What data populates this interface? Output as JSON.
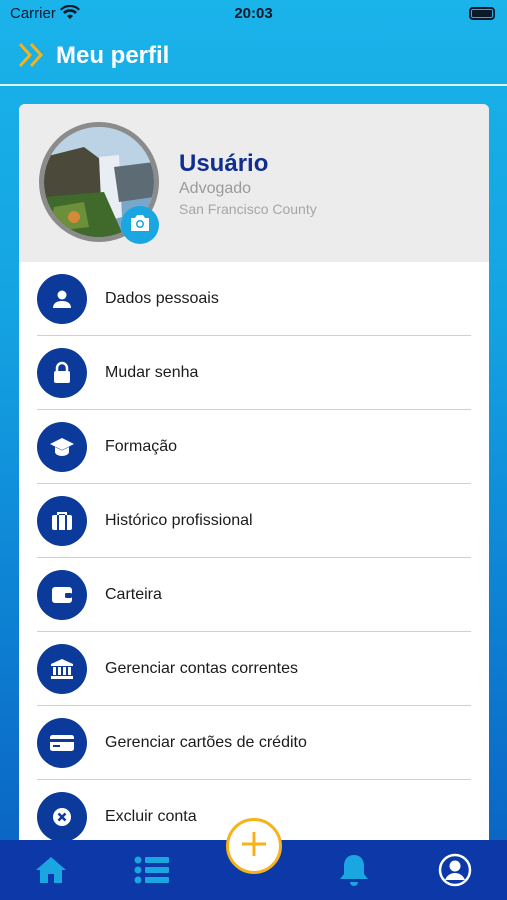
{
  "status_bar": {
    "carrier": "Carrier",
    "time": "20:03"
  },
  "header": {
    "title": "Meu perfil"
  },
  "profile": {
    "name": "Usuário",
    "role": "Advogado",
    "location": "San Francisco County"
  },
  "menu": [
    {
      "label": "Dados pessoais",
      "icon": "person-icon"
    },
    {
      "label": "Mudar senha",
      "icon": "lock-icon"
    },
    {
      "label": "Formação",
      "icon": "graduation-cap-icon"
    },
    {
      "label": "Histórico profissional",
      "icon": "briefcase-icon"
    },
    {
      "label": "Carteira",
      "icon": "wallet-icon"
    },
    {
      "label": "Gerenciar contas correntes",
      "icon": "bank-icon"
    },
    {
      "label": "Gerenciar cartões de crédito",
      "icon": "credit-card-icon"
    },
    {
      "label": "Excluir conta",
      "icon": "close-circle-icon"
    }
  ],
  "tab_bar": {
    "items": [
      "home-icon",
      "list-icon",
      "add-icon",
      "bell-icon",
      "profile-icon"
    ]
  },
  "colors": {
    "accent": "#0c3a9a",
    "brand_blue": "#1aa6e1",
    "fab_border": "#f5b21a"
  }
}
